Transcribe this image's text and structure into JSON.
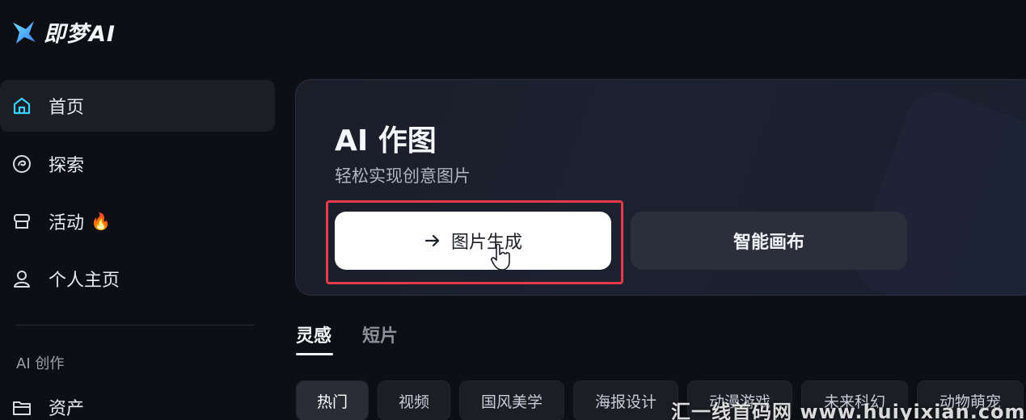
{
  "app": {
    "logo_text": "即梦AI"
  },
  "sidebar": {
    "items": [
      {
        "label": "首页",
        "icon": "home-icon"
      },
      {
        "label": "探索",
        "icon": "explore-icon"
      },
      {
        "label": "活动",
        "icon": "activity-icon",
        "badge": "fire-icon"
      },
      {
        "label": "个人主页",
        "icon": "user-icon"
      }
    ],
    "section_label": "AI 创作",
    "assets_label": "资产"
  },
  "hero": {
    "title": "AI 作图",
    "subtitle": "轻松实现创意图片",
    "primary_button": "图片生成",
    "secondary_button": "智能画布"
  },
  "tabs": [
    {
      "label": "灵感",
      "active": true
    },
    {
      "label": "短片",
      "active": false
    }
  ],
  "chips": [
    "热门",
    "视频",
    "国风美学",
    "海报设计",
    "动漫游戏",
    "未来科幻",
    "动物萌宠"
  ],
  "watermark": "汇一线首码网 www.huiyixian.com",
  "colors": {
    "highlight": "#e53a4a",
    "accent": "#3ad0ff",
    "fire": "#ff7a1a"
  }
}
